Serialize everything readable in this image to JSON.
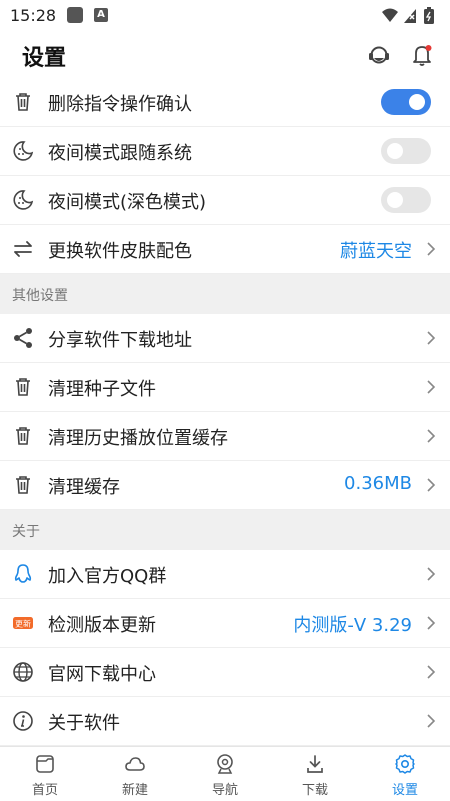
{
  "status_bar": {
    "time": "15:28",
    "a_badge": "A"
  },
  "header": {
    "title": "设置"
  },
  "main_items": [
    {
      "label": "删除指令操作确认",
      "icon": "trash-icon",
      "toggle": "on"
    },
    {
      "label": "夜间模式跟随系统",
      "icon": "night-mode-icon",
      "toggle": "off"
    },
    {
      "label": "夜间模式(深色模式)",
      "icon": "night-mode-icon",
      "toggle": "off"
    },
    {
      "label": "更换软件皮肤配色",
      "icon": "swap-icon",
      "value": "蔚蓝天空"
    }
  ],
  "sections": {
    "other": {
      "title": "其他设置",
      "items": [
        {
          "label": "分享软件下载地址",
          "icon": "share-icon"
        },
        {
          "label": "清理种子文件",
          "icon": "trash-icon"
        },
        {
          "label": "清理历史播放位置缓存",
          "icon": "trash-icon"
        },
        {
          "label": "清理缓存",
          "icon": "trash-icon",
          "value": "0.36MB"
        }
      ]
    },
    "about": {
      "title": "关于",
      "items": [
        {
          "label": "加入官方QQ群",
          "icon": "qq-icon"
        },
        {
          "label": "检测版本更新",
          "icon": "update-badge-icon",
          "badge": "更新",
          "value": "内测版-V 3.29"
        },
        {
          "label": "官网下载中心",
          "icon": "globe-icon"
        },
        {
          "label": "关于软件",
          "icon": "info-icon"
        }
      ]
    }
  },
  "bottom_nav": [
    {
      "label": "首页",
      "icon": "home-icon",
      "active": false
    },
    {
      "label": "新建",
      "icon": "cloud-icon",
      "active": false
    },
    {
      "label": "导航",
      "icon": "navigation-icon",
      "active": false
    },
    {
      "label": "下载",
      "icon": "download-icon",
      "active": false
    },
    {
      "label": "设置",
      "icon": "gear-icon",
      "active": true
    }
  ],
  "colors": {
    "accent": "#1e88e5",
    "toggle_on": "#3b82e8",
    "badge": "#f26b2a"
  }
}
